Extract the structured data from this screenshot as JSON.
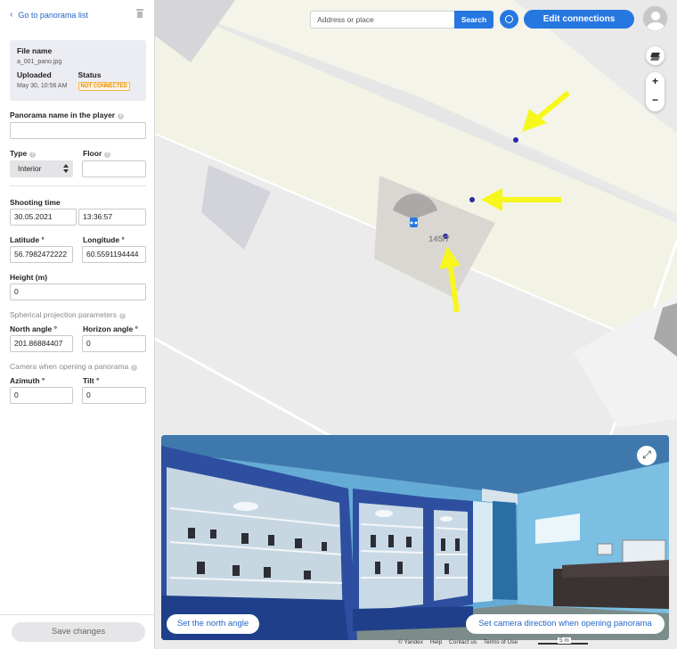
{
  "sidebar": {
    "back_label": "Go to panorama list",
    "file": {
      "title": "File name",
      "name": "a_001_pano.jpg",
      "uploaded_label": "Uploaded",
      "uploaded_value": "May 30, 10:56 AM",
      "status_label": "Status",
      "status_value": "NOT CONNECTED"
    },
    "panorama_name_label": "Panorama name in the player",
    "panorama_name_value": "",
    "type_label": "Type",
    "type_value": "Interior",
    "floor_label": "Floor",
    "floor_value": "",
    "shooting_time_label": "Shooting time",
    "shooting_date": "30.05.2021",
    "shooting_clock": "13:36:57",
    "latitude_label": "Latitude °",
    "latitude_value": "56.7982472222",
    "longitude_label": "Longitude °",
    "longitude_value": "60.5591194444",
    "height_label": "Height (m)",
    "height_value": "0",
    "spherical_label": "Spherical projection parameters",
    "north_angle_label": "North angle °",
    "north_angle_value": "201.86884407",
    "horizon_angle_label": "Horizon angle °",
    "horizon_angle_value": "0",
    "camera_label": "Camera when opening a panorama",
    "azimuth_label": "Azimuth °",
    "azimuth_value": "0",
    "tilt_label": "Tilt °",
    "tilt_value": "0",
    "save_label": "Save changes"
  },
  "map": {
    "search_placeholder": "Address or place",
    "search_button": "Search",
    "edit_connections": "Edit connections",
    "zoom_in": "+",
    "zoom_out": "−",
    "building_number": "145/7",
    "annotation_color": "#f7f71e"
  },
  "panorama": {
    "set_north": "Set the north angle",
    "set_camera": "Set camera direction when opening panorama"
  },
  "footer": {
    "copyright": "© Yandex",
    "help": "Help",
    "contact": "Contact us",
    "terms": "Terms of Use",
    "scale": "5 m"
  },
  "icons": {
    "back": "chevron-left-icon",
    "delete": "trash-icon",
    "help": "question-icon",
    "fit": "fit-view-icon",
    "layers": "layers-icon",
    "expand": "expand-icon",
    "panorama_marker": "panorama-marker-icon"
  }
}
